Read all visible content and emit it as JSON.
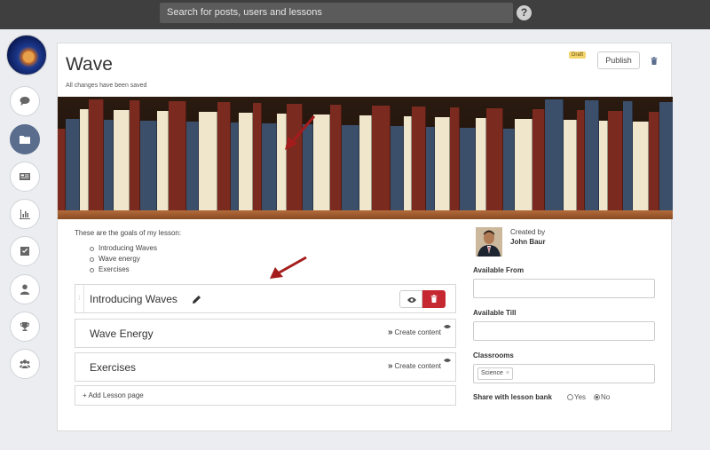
{
  "topbar": {
    "search_placeholder": "Search for posts, users and lessons",
    "help_icon": "?"
  },
  "sidebar": {
    "items": [
      {
        "icon": "comment-icon"
      },
      {
        "icon": "folder-icon",
        "active": true
      },
      {
        "icon": "newspaper-icon"
      },
      {
        "icon": "bar-chart-icon"
      },
      {
        "icon": "checkbox-icon"
      },
      {
        "icon": "user-icon"
      },
      {
        "icon": "trophy-icon"
      },
      {
        "icon": "group-icon"
      }
    ]
  },
  "lesson": {
    "title": "Wave",
    "save_status": "All changes have been saved",
    "status_badge": "Draft",
    "publish_label": "Publish",
    "goals_intro": "These are the goals of my lesson:",
    "goals": [
      "Introducing Waves",
      "Wave energy",
      "Exercises"
    ],
    "pages": [
      {
        "title": "Introducing Waves",
        "editing": true
      },
      {
        "title": "Wave Energy",
        "action": "Create content"
      },
      {
        "title": "Exercises",
        "action": "Create content"
      }
    ],
    "add_page_label": "+ Add Lesson page"
  },
  "details": {
    "created_by_label": "Created by",
    "author": "John Baur",
    "available_from_label": "Available From",
    "available_from_value": "",
    "available_till_label": "Available Till",
    "available_till_value": "",
    "classrooms_label": "Classrooms",
    "classroom_tag": "Science",
    "tag_remove": "×",
    "share_label": "Share with lesson bank",
    "share_options": [
      "Yes",
      "No"
    ],
    "share_selected": "No"
  },
  "colors": {
    "accent_delete": "#c62832",
    "draft_badge": "#f3d46d",
    "active_rail": "#5a6d8d",
    "annotation_arrow": "#a51c1c"
  }
}
